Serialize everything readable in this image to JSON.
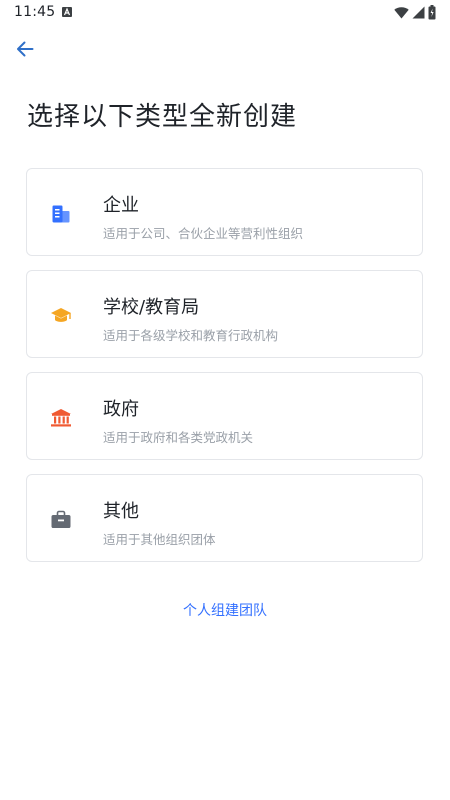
{
  "status_bar": {
    "time": "11:45"
  },
  "page": {
    "title": "选择以下类型全新创建"
  },
  "options": [
    {
      "title": "企业",
      "description": "适用于公司、合伙企业等营利性组织",
      "icon": "building-icon",
      "color": "#3370ff"
    },
    {
      "title": "学校/教育局",
      "description": "适用于各级学校和教育行政机构",
      "icon": "graduation-cap-icon",
      "color": "#f5a623"
    },
    {
      "title": "政府",
      "description": "适用于政府和各类党政机关",
      "icon": "government-building-icon",
      "color": "#f05a32"
    },
    {
      "title": "其他",
      "description": "适用于其他组织团体",
      "icon": "briefcase-icon",
      "color": "#646a73"
    }
  ],
  "personal_team_link": "个人组建团队"
}
